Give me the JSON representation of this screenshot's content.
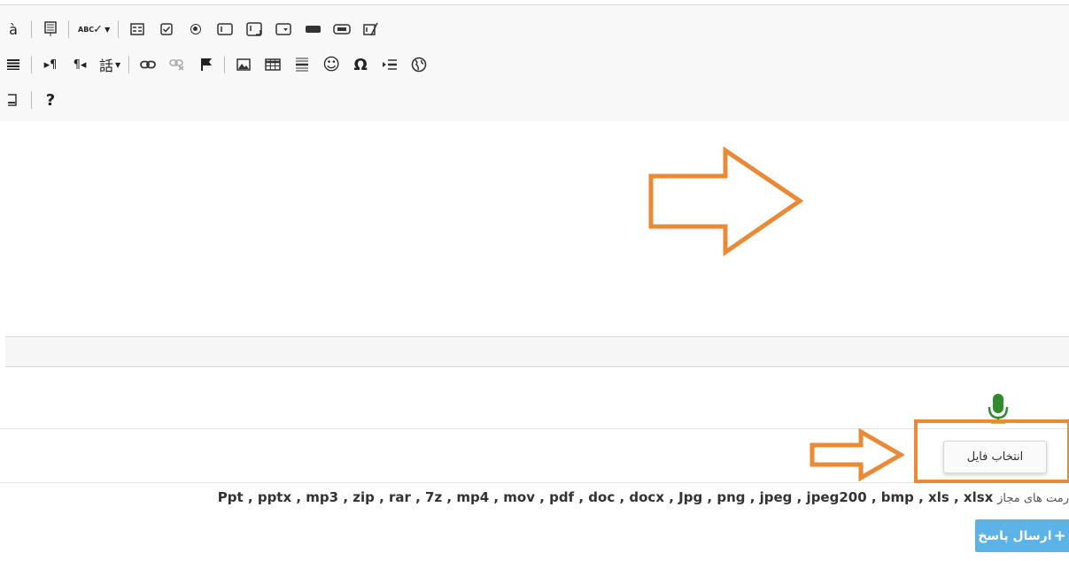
{
  "toolbar": {
    "row1_partial_glyph": "à",
    "row3_help": "?",
    "row2_pilcrow_ltr": "¶",
    "row2_pilcrow_rtl": "¶",
    "row2_lang": "話",
    "row2_omega": "Ω",
    "row2_smiley": "☺",
    "spellcheck_label": "ABC"
  },
  "upload": {
    "choose_file_label": "انتخاب فایل"
  },
  "formats": {
    "label": "رمت های مجاز",
    "list": "Ppt , pptx , mp3 , zip , rar , 7z , mp4 , mov , pdf , doc , docx , Jpg , png , jpeg , jpeg200 , bmp , xls , xlsx"
  },
  "actions": {
    "send_reply_label": "ارسال پاسخ",
    "send_icon": "+"
  },
  "colors": {
    "arrow_orange": "#ea8a36",
    "send_button": "#5bb3e8",
    "mic_green": "#2e8b2e"
  },
  "icons": [
    "microphone-icon",
    "arrow-right-annotation",
    "highlight-box-annotation"
  ]
}
